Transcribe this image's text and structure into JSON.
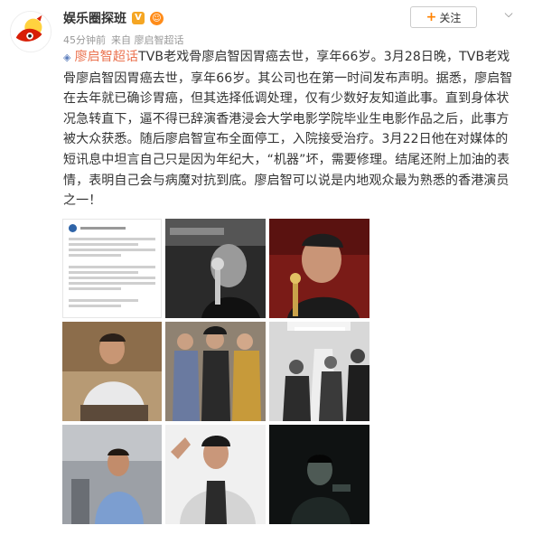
{
  "header": {
    "username": "娱乐圈探班",
    "verified_badge": "V",
    "follow_label": "关注",
    "follow_plus": "+",
    "more_glyph": "⌵"
  },
  "meta": {
    "time": "45分钟前",
    "source": "来自 廖启智超话"
  },
  "post": {
    "tag": "廖启智超话",
    "body": "TVB老戏骨廖启智因胃癌去世，享年66岁。3月28日晚，TVB老戏骨廖启智因胃癌去世，享年66岁。其公司也在第一时间发布声明。据悉，廖启智在去年就已确诊胃癌，但其选择低调处理，仅有少数好友知道此事。直到身体状况急转直下，逼不得已辞演香港浸会大学电影学院毕业生电影作品之后，此事方被大众获悉。随后廖启智宣布全面停工，入院接受治疗。3月22日他在对媒体的短讯息中坦言自己只是因为年纪大，“机器”坏，需要修理。结尾还附上加油的表情，表明自己会与病魔对抗到底。廖启智可以说是内地观众最为熟悉的香港演员之一！"
  },
  "photos": [
    {
      "id": "photo-1",
      "kind": "statement"
    },
    {
      "id": "photo-2",
      "kind": "award-bw"
    },
    {
      "id": "photo-3",
      "kind": "award-color"
    },
    {
      "id": "photo-4",
      "kind": "seated-man"
    },
    {
      "id": "photo-5",
      "kind": "group-vintage"
    },
    {
      "id": "photo-6",
      "kind": "hospital-bw"
    },
    {
      "id": "photo-7",
      "kind": "standing-man"
    },
    {
      "id": "photo-8",
      "kind": "jacket-man"
    },
    {
      "id": "photo-9",
      "kind": "dark-scene"
    }
  ],
  "colors": {
    "accent_orange": "#ff8200",
    "tag_color": "#eb7350",
    "meta_gray": "#999999",
    "text": "#333333"
  },
  "icons": {
    "avatar": "weibo-eye-logo-icon",
    "verified": "verified-v-icon",
    "level": "face-badge-icon",
    "more": "chevron-down-icon",
    "tag": "super-topic-diamond-icon"
  }
}
